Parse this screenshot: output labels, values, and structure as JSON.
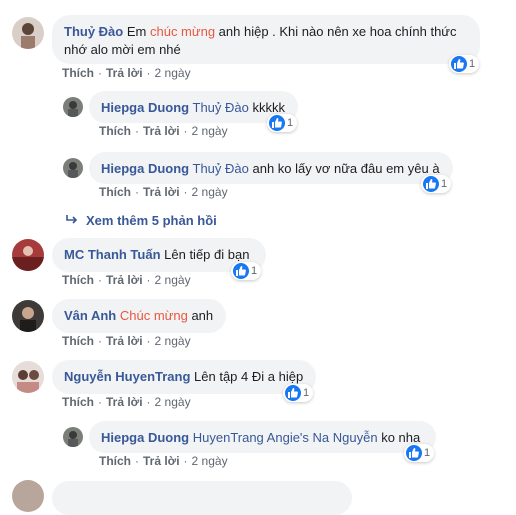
{
  "comments": [
    {
      "author": "Thuỷ Đào",
      "text1_before": "Em ",
      "text1_hl": "chúc mừng",
      "text1_after": " anh hiệp . Khi nào nên xe hoa chính thức",
      "text2": "nhớ alo mời em nhé",
      "reactions": "1",
      "like": "Thích",
      "reply": "Trả lời",
      "time": "2 ngày"
    },
    {
      "author": "Hiepga Duong",
      "tag": "Thuỷ Đào",
      "text": " kkkkk",
      "reactions": "1",
      "like": "Thích",
      "reply": "Trả lời",
      "time": "2 ngày"
    },
    {
      "author": "Hiepga Duong",
      "tag": "Thuỷ Đào",
      "text": " anh ko lấy vơ nữa đâu em yêu à",
      "reactions": "1",
      "like": "Thích",
      "reply": "Trả lời",
      "time": "2 ngày"
    },
    {
      "author": "MC Thanh Tuấn",
      "text": " Lên tiếp đi bạn",
      "reactions": "1",
      "like": "Thích",
      "reply": "Trả lời",
      "time": "2 ngày"
    },
    {
      "author": "Vân Anh",
      "text_hl": "Chúc mừng",
      "text_after": " anh",
      "like": "Thích",
      "reply": "Trả lời",
      "time": "2 ngày"
    },
    {
      "author": "Nguyễn HuyenTrang",
      "text": " Lên tập 4 Đi a hiệp",
      "reactions": "1",
      "like": "Thích",
      "reply": "Trả lời",
      "time": "2 ngày"
    },
    {
      "author": "Hiepga Duong",
      "tag": "HuyenTrang Angie's Na Nguyễn",
      "text": " ko nha",
      "reactions": "1",
      "like": "Thích",
      "reply": "Trả lời",
      "time": "2 ngày"
    }
  ],
  "more_replies": "Xem thêm 5 phản hồi",
  "colors": {
    "link": "#385898",
    "highlight": "#e9573f",
    "bubble": "#f2f3f5",
    "like_blue": "#1877f2"
  }
}
